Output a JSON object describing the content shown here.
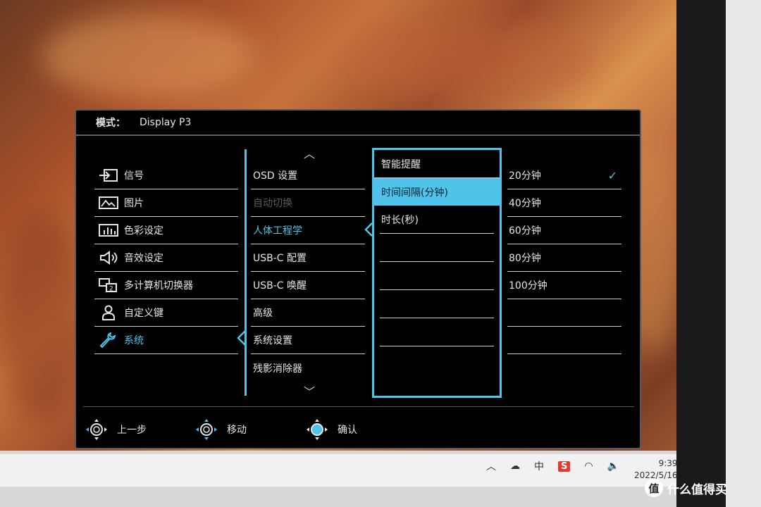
{
  "header": {
    "mode_label": "模式：",
    "mode_value": "Display P3"
  },
  "menu_l1": [
    {
      "label": "信号",
      "icon": "input-icon",
      "active": false
    },
    {
      "label": "图片",
      "icon": "picture-icon",
      "active": false
    },
    {
      "label": "色彩设定",
      "icon": "color-bars-icon",
      "active": false
    },
    {
      "label": "音效设定",
      "icon": "speaker-icon",
      "active": false
    },
    {
      "label": "多计算机切换器",
      "icon": "multi-screen-icon",
      "active": false
    },
    {
      "label": "自定义键",
      "icon": "person-icon",
      "active": false
    },
    {
      "label": "系统",
      "icon": "wrench-icon",
      "active": true
    }
  ],
  "menu_l2": [
    {
      "label": "OSD 设置",
      "state": "normal"
    },
    {
      "label": "自动切换",
      "state": "disabled"
    },
    {
      "label": "人体工程学",
      "state": "active"
    },
    {
      "label": "USB-C 配置",
      "state": "normal"
    },
    {
      "label": "USB-C 唤醒",
      "state": "normal"
    },
    {
      "label": "高级",
      "state": "normal"
    },
    {
      "label": "系统设置",
      "state": "normal"
    },
    {
      "label": "残影消除器",
      "state": "normal"
    }
  ],
  "menu_l3": [
    {
      "label": "智能提醒",
      "selected": false
    },
    {
      "label": "时间间隔(分钟)",
      "selected": true
    },
    {
      "label": "时长(秒)",
      "selected": false
    },
    {
      "label": "",
      "selected": false
    },
    {
      "label": "",
      "selected": false
    },
    {
      "label": "",
      "selected": false
    },
    {
      "label": "",
      "selected": false
    }
  ],
  "menu_l4": [
    {
      "label": "20分钟",
      "checked": true
    },
    {
      "label": "40分钟",
      "checked": false
    },
    {
      "label": "60分钟",
      "checked": false
    },
    {
      "label": "80分钟",
      "checked": false
    },
    {
      "label": "100分钟",
      "checked": false
    },
    {
      "label": "",
      "checked": false
    },
    {
      "label": "",
      "checked": false
    }
  ],
  "footer": {
    "back_label": "上一步",
    "move_label": "移动",
    "confirm_label": "确认"
  },
  "tray": {
    "ime_label": "中",
    "time": "9:39",
    "date": "2022/5/16"
  },
  "watermark": {
    "badge": "值",
    "text": "什么值得买"
  },
  "colors": {
    "accent": "#4fc3ea",
    "osd_bg": "#000000"
  }
}
